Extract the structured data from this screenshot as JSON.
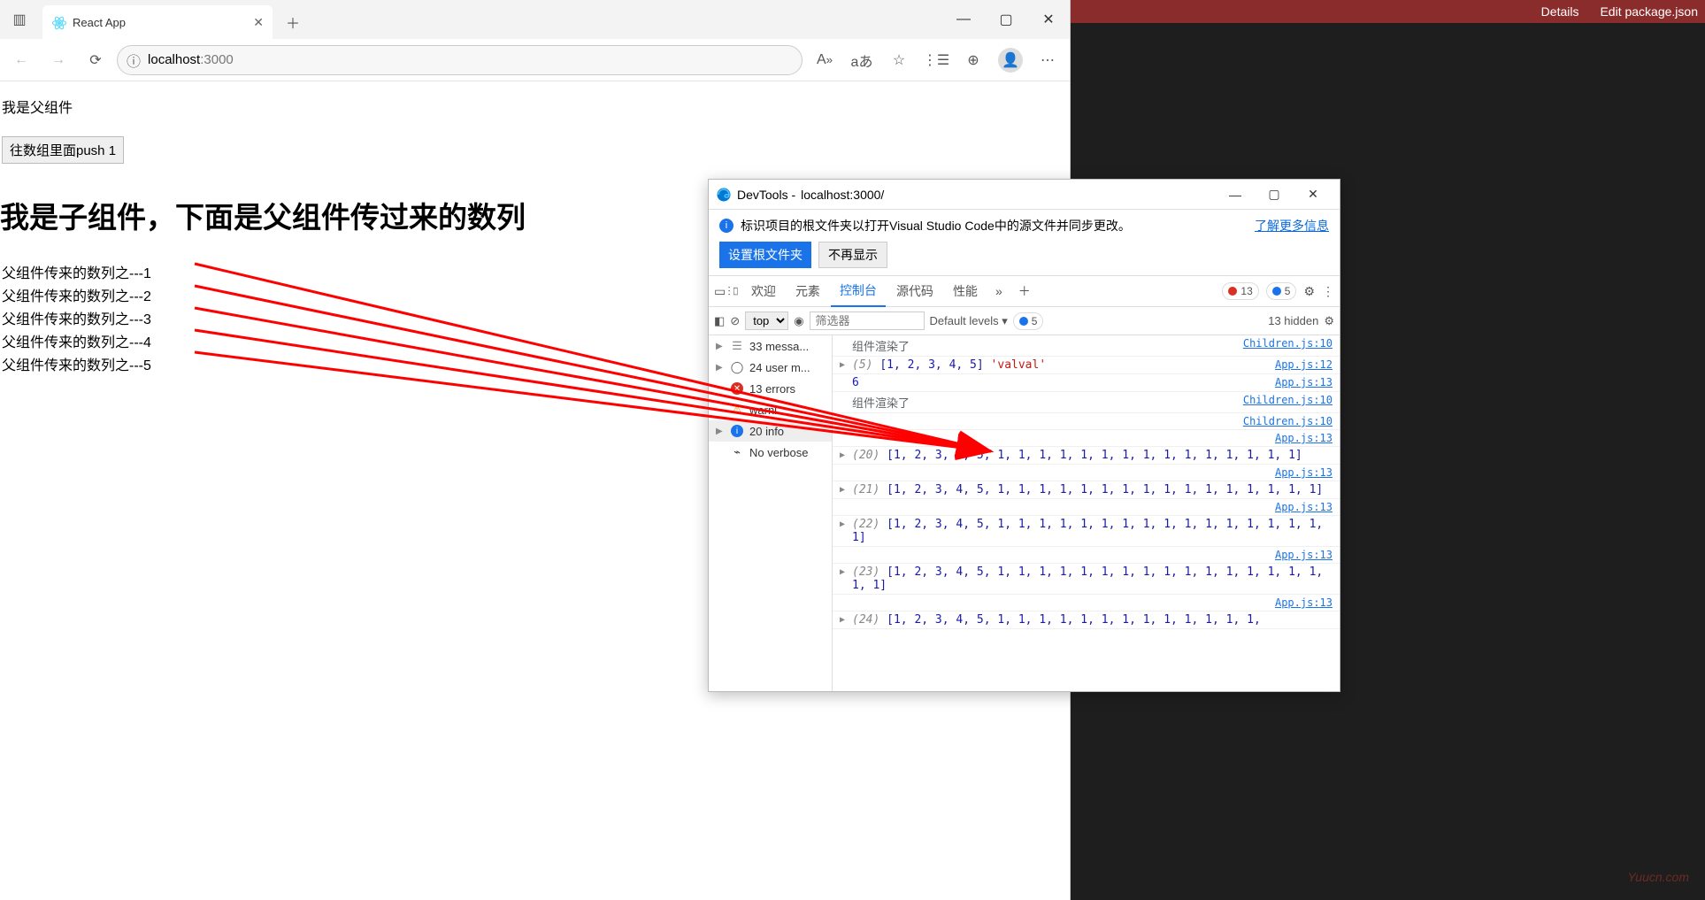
{
  "browser": {
    "tab_title": "React App",
    "url_host": "localhost",
    "url_port": ":3000",
    "window_controls": {
      "min": "—",
      "max": "▢",
      "close": "✕"
    }
  },
  "page": {
    "parent_label": "我是父组件",
    "push_button": "往数组里面push 1",
    "child_heading": "我是子组件，下面是父组件传过来的数列",
    "rows": [
      "父组件传来的数列之---1",
      "父组件传来的数列之---2",
      "父组件传来的数列之---3",
      "父组件传来的数列之---4",
      "父组件传来的数列之---5"
    ]
  },
  "editor": {
    "links": [
      "Details",
      "Edit package.json"
    ]
  },
  "devtools": {
    "title_prefix": "DevTools - ",
    "title_url": "localhost:3000/",
    "info_text": "标识项目的根文件夹以打开Visual Studio Code中的源文件并同步更改。",
    "learn_more": "了解更多信息",
    "btn_set_root": "设置根文件夹",
    "btn_dismiss": "不再显示",
    "tabs": {
      "welcome": "欢迎",
      "elements": "元素",
      "console": "控制台",
      "sources": "源代码",
      "performance": "性能"
    },
    "badge_errors": "13",
    "badge_info": "5",
    "context_label": "top",
    "filter_placeholder": "筛选器",
    "levels_label": "Default levels",
    "issues_count": "5",
    "hidden_label": "13 hidden",
    "sidebar": {
      "messages": "33 messa...",
      "user": "24 user m...",
      "errors": "13 errors",
      "warnings": "warni",
      "info": "20 info",
      "verbose": "No verbose"
    },
    "logs": [
      {
        "type": "zh",
        "text": "组件渲染了",
        "src": "Children.js:10"
      },
      {
        "type": "arr",
        "count": 5,
        "arr": "[1, 2, 3, 4, 5]",
        "extra": "'valval'",
        "src": "App.js:12"
      },
      {
        "type": "plain",
        "text": "6",
        "src": "App.js:13"
      },
      {
        "type": "zh",
        "text": "组件渲染了",
        "src": "Children.js:10"
      },
      {
        "type": "src_only",
        "src": "Children.js:10"
      },
      {
        "type": "src_only",
        "src": "App.js:13"
      },
      {
        "type": "arr",
        "count": 20,
        "arr": "[1, 2, 3, 4, 5, 1, 1, 1, 1, 1, 1, 1, 1, 1, 1, 1, 1, 1, 1, 1]",
        "src": ""
      },
      {
        "type": "src_only",
        "src": "App.js:13"
      },
      {
        "type": "arr",
        "count": 21,
        "arr": "[1, 2, 3, 4, 5, 1, 1, 1, 1, 1, 1, 1, 1, 1, 1, 1, 1, 1, 1, 1, 1]",
        "src": ""
      },
      {
        "type": "src_only",
        "src": "App.js:13"
      },
      {
        "type": "arr",
        "count": 22,
        "arr": "[1, 2, 3, 4, 5, 1, 1, 1, 1, 1, 1, 1, 1, 1, 1, 1, 1, 1, 1, 1, 1, 1]",
        "src": ""
      },
      {
        "type": "src_only",
        "src": "App.js:13"
      },
      {
        "type": "arr",
        "count": 23,
        "arr": "[1, 2, 3, 4, 5, 1, 1, 1, 1, 1, 1, 1, 1, 1, 1, 1, 1, 1, 1, 1, 1, 1, 1]",
        "src": ""
      },
      {
        "type": "src_only",
        "src": "App.js:13"
      },
      {
        "type": "arr",
        "count": 24,
        "arr": "[1, 2, 3, 4, 5, 1, 1, 1, 1, 1, 1, 1, 1, 1, 1, 1, 1, 1,",
        "src": ""
      }
    ]
  },
  "watermark": "Yuucn.com",
  "chart_data": {
    "type": "table",
    "title": "父组件传过来的数列",
    "categories": [
      "1",
      "2",
      "3",
      "4",
      "5"
    ],
    "values": [
      1,
      2,
      3,
      4,
      5
    ]
  }
}
